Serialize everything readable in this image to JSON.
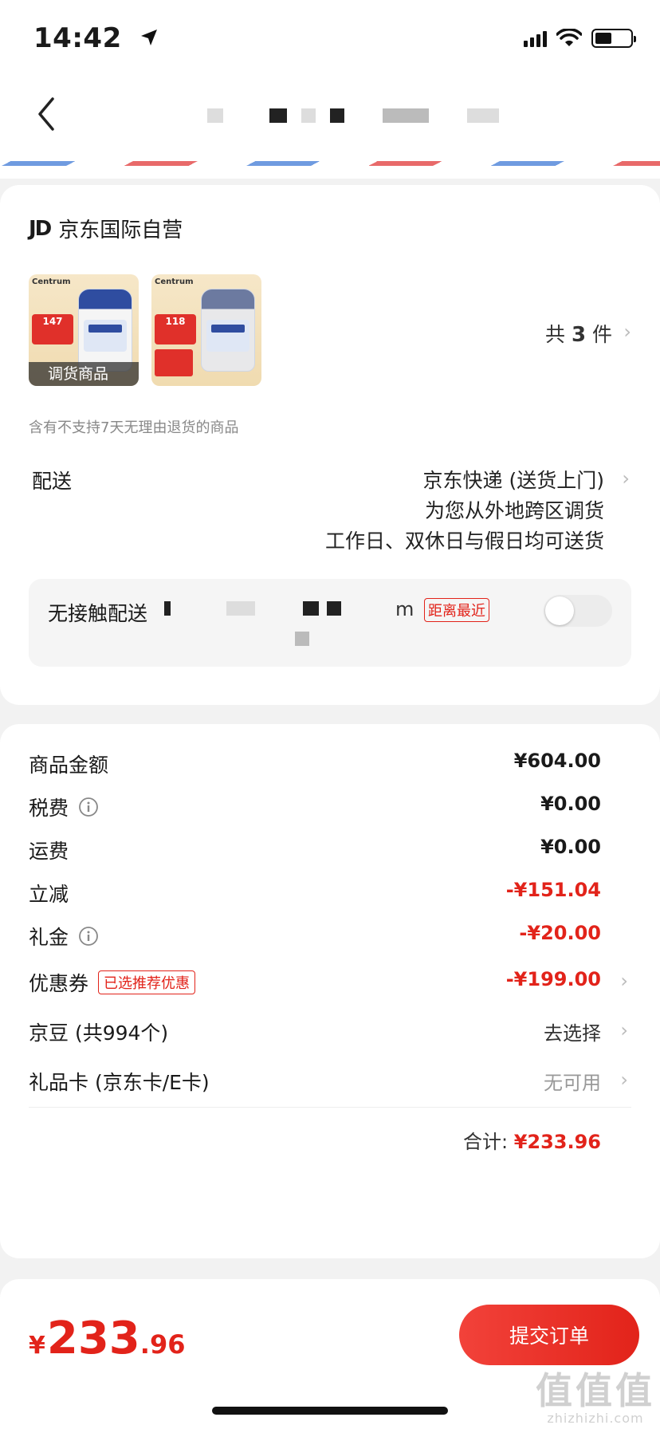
{
  "status_bar": {
    "time": "14:42",
    "location_icon": "location-arrow-icon",
    "signal_icon": "cellular-signal-icon",
    "wifi_icon": "wifi-icon",
    "battery_icon": "battery-icon",
    "battery_level": 0.4
  },
  "nav": {
    "back_icon": "chevron-left-icon"
  },
  "store": {
    "logo": "JD",
    "name": "京东国际自营"
  },
  "products": {
    "thumb1": {
      "brand": "Centrum",
      "price_tag": "147",
      "badge": "调货商品"
    },
    "thumb2": {
      "brand": "Centrum",
      "price_tag": "118"
    },
    "count_prefix": "共",
    "count": "3",
    "count_suffix": "件",
    "no_return_notice": "含有不支持7天无理由退货的商品"
  },
  "delivery": {
    "label": "配送",
    "line1": "京东快递 (送货上门)",
    "line2": "为您从外地跨区调货",
    "line3": "工作日、双休日与假日均可送货"
  },
  "contactless": {
    "label": "无接触配送",
    "unit": "m",
    "tag": "距离最近",
    "enabled": false
  },
  "price_rows": [
    {
      "label": "商品金额",
      "value": "¥604.00"
    },
    {
      "label": "税费",
      "value": "¥0.00"
    },
    {
      "label": "运费",
      "value": "¥0.00"
    },
    {
      "label": "立减",
      "value": "-¥151.04"
    },
    {
      "label": "礼金",
      "value": "-¥20.00"
    },
    {
      "label": "优惠券",
      "tag": "已选推荐优惠",
      "value": "-¥199.00"
    },
    {
      "label": "京豆 (共994个)",
      "value": "去选择"
    },
    {
      "label": "礼品卡 (京东卡/E卡)",
      "value": "无可用"
    }
  ],
  "total": {
    "label": "合计:",
    "amount": "¥233.96"
  },
  "bottom": {
    "currency": "¥",
    "integer": "233",
    "decimal": ".96",
    "submit_label": "提交订单"
  },
  "watermark": {
    "main": "值值值",
    "sub": "zhizhizhi.com"
  },
  "colors": {
    "accent_red": "#e2231a",
    "background": "#f2f2f2"
  }
}
